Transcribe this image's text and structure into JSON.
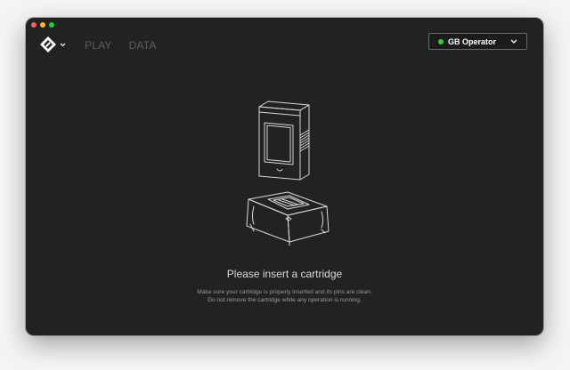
{
  "window": {
    "controls": [
      "close",
      "minimize",
      "zoom"
    ]
  },
  "header": {
    "logo_icon": "cartridge-logo-icon",
    "menu_chevron_icon": "chevron-down-icon",
    "nav": [
      {
        "label": "PLAY"
      },
      {
        "label": "DATA"
      }
    ],
    "device": {
      "name": "GB Operator",
      "status_color": "#2ecc40",
      "dropdown_icon": "chevron-down-icon"
    }
  },
  "main": {
    "illustration_icon": "cartridge-in-dock-illustration",
    "title": "Please insert a cartridge",
    "description_line1": "Make sure your cartridge is properly inserted and its pins are clean.",
    "description_line2": "Do not remove the cartridge while any operation is running."
  },
  "colors": {
    "background": "#222222",
    "accent_status": "#2ecc40"
  }
}
